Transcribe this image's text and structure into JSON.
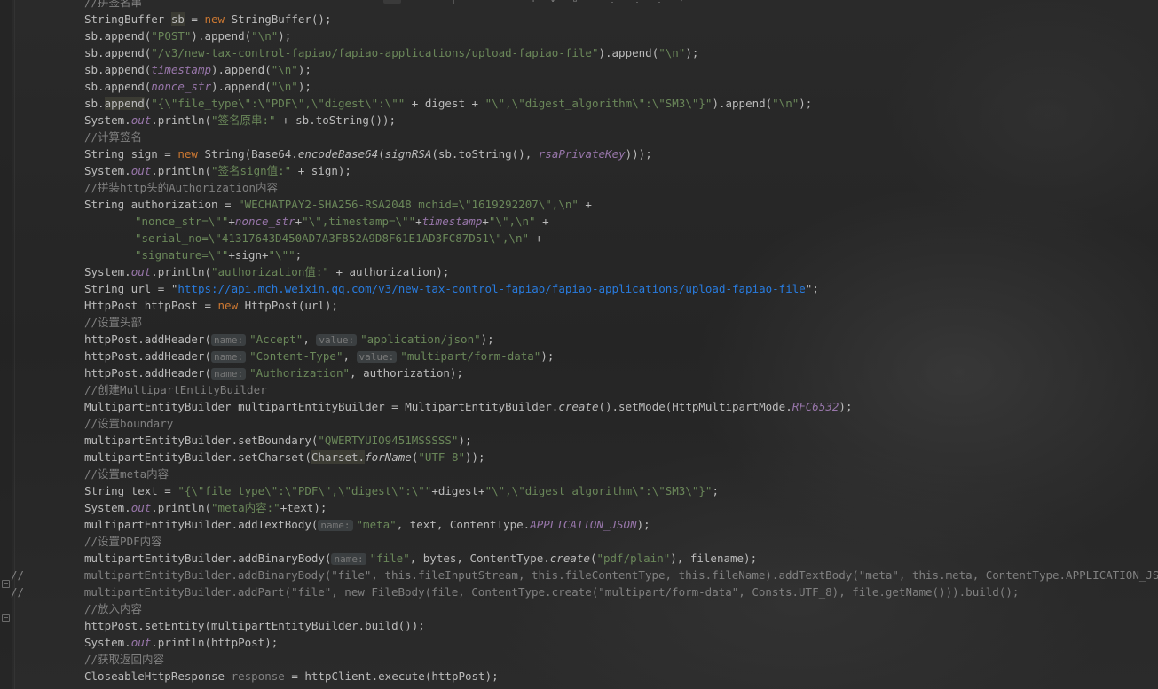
{
  "editor": {
    "language": "java",
    "lines": [
      {
        "indent": 95,
        "segments": [
          {
            "t": "//拼签名串",
            "c": "cmt"
          }
        ]
      },
      {
        "indent": 95,
        "segments": [
          {
            "t": "StringBuffer "
          },
          {
            "t": "sb",
            "c": "hl"
          },
          {
            "t": " = "
          },
          {
            "t": "new",
            "c": "kw"
          },
          {
            "t": " StringBuffer();"
          }
        ]
      },
      {
        "indent": 95,
        "segments": [
          {
            "t": "sb.append("
          },
          {
            "t": "\"POST\"",
            "c": "str"
          },
          {
            "t": ").append("
          },
          {
            "t": "\"\\n\"",
            "c": "str"
          },
          {
            "t": ");"
          }
        ]
      },
      {
        "indent": 95,
        "segments": [
          {
            "t": "sb.append("
          },
          {
            "t": "\"/v3/new-tax-control-fapiao/fapiao-applications/upload-fapiao-file\"",
            "c": "str"
          },
          {
            "t": ").append("
          },
          {
            "t": "\"\\n\"",
            "c": "str"
          },
          {
            "t": ");"
          }
        ]
      },
      {
        "indent": 95,
        "segments": [
          {
            "t": "sb.append("
          },
          {
            "t": "timestamp",
            "c": "fld"
          },
          {
            "t": ").append("
          },
          {
            "t": "\"\\n\"",
            "c": "str"
          },
          {
            "t": ");"
          }
        ]
      },
      {
        "indent": 95,
        "segments": [
          {
            "t": "sb.append("
          },
          {
            "t": "nonce_str",
            "c": "fld"
          },
          {
            "t": ").append("
          },
          {
            "t": "\"\\n\"",
            "c": "str"
          },
          {
            "t": ");"
          }
        ]
      },
      {
        "indent": 95,
        "segments": [
          {
            "t": "sb."
          },
          {
            "t": "append",
            "c": "hl"
          },
          {
            "t": "("
          },
          {
            "t": "\"{\\\"file_type\\\":\\\"PDF\\\",\\\"digest\\\":\\\"\"",
            "c": "str"
          },
          {
            "t": " + digest + "
          },
          {
            "t": "\"\\\",\\\"digest_algorithm\\\":\\\"SM3\\\"}\"",
            "c": "str"
          },
          {
            "t": ").append("
          },
          {
            "t": "\"\\n\"",
            "c": "str"
          },
          {
            "t": ");"
          }
        ]
      },
      {
        "indent": 95,
        "segments": [
          {
            "t": "System."
          },
          {
            "t": "out",
            "c": "fld"
          },
          {
            "t": ".println("
          },
          {
            "t": "\"签名原串:\"",
            "c": "str"
          },
          {
            "t": " + sb.toString());"
          }
        ]
      },
      {
        "indent": 95,
        "segments": [
          {
            "t": "//计算签名",
            "c": "cmt"
          }
        ]
      },
      {
        "indent": 95,
        "segments": [
          {
            "t": "String sign = "
          },
          {
            "t": "new",
            "c": "kw"
          },
          {
            "t": " String(Base64."
          },
          {
            "t": "encodeBase64",
            "c": "itl"
          },
          {
            "t": "("
          },
          {
            "t": "signRSA",
            "c": "itl"
          },
          {
            "t": "(sb.toString(), "
          },
          {
            "t": "rsaPrivateKey",
            "c": "fld"
          },
          {
            "t": ")));"
          }
        ]
      },
      {
        "indent": 95,
        "segments": [
          {
            "t": "System."
          },
          {
            "t": "out",
            "c": "fld"
          },
          {
            "t": ".println("
          },
          {
            "t": "\"签名sign值:\"",
            "c": "str"
          },
          {
            "t": " + sign);"
          }
        ]
      },
      {
        "indent": 95,
        "segments": [
          {
            "t": "//拼装http头的Authorization内容",
            "c": "cmt"
          }
        ]
      },
      {
        "indent": 95,
        "segments": [
          {
            "t": "String authorization = "
          },
          {
            "t": "\"WECHATPAY2-SHA256-RSA2048 mchid=\\\"1619292207\\\",\\n\"",
            "c": "str"
          },
          {
            "t": " +"
          }
        ]
      },
      {
        "indent": 152,
        "segments": [
          {
            "t": "\"nonce_str=\\\"\"",
            "c": "str"
          },
          {
            "t": "+"
          },
          {
            "t": "nonce_str",
            "c": "fld"
          },
          {
            "t": "+"
          },
          {
            "t": "\"\\\",timestamp=\\\"\"",
            "c": "str"
          },
          {
            "t": "+"
          },
          {
            "t": "timestamp",
            "c": "fld"
          },
          {
            "t": "+"
          },
          {
            "t": "\"\\\",\\n\"",
            "c": "str"
          },
          {
            "t": " +"
          }
        ]
      },
      {
        "indent": 152,
        "segments": [
          {
            "t": "\"serial_no=\\\"41317643D450AD7A3F852A9D8F61E1AD3FC87D51\\\",\\n\"",
            "c": "str"
          },
          {
            "t": " +"
          }
        ]
      },
      {
        "indent": 152,
        "segments": [
          {
            "t": "\"signature=\\\"\"",
            "c": "str"
          },
          {
            "t": "+sign+"
          },
          {
            "t": "\"\\\"\"",
            "c": "str"
          },
          {
            "t": ";"
          }
        ]
      },
      {
        "indent": 95,
        "segments": [
          {
            "t": "System."
          },
          {
            "t": "out",
            "c": "fld"
          },
          {
            "t": ".println("
          },
          {
            "t": "\"authorization值:\"",
            "c": "str"
          },
          {
            "t": " + authorization);"
          }
        ]
      },
      {
        "indent": 95,
        "segments": [
          {
            "t": "String url = "
          },
          {
            "t": "\""
          },
          {
            "t": "https://api.mch.weixin.qq.com/v3/new-tax-control-fapiao/fapiao-applications/upload-fapiao-file",
            "c": "url"
          },
          {
            "t": "\""
          },
          {
            "t": ";"
          }
        ]
      },
      {
        "indent": 95,
        "segments": [
          {
            "t": "HttpPost httpPost = "
          },
          {
            "t": "new",
            "c": "kw"
          },
          {
            "t": " HttpPost(url);"
          }
        ]
      },
      {
        "indent": 95,
        "segments": [
          {
            "t": "//设置头部",
            "c": "cmt"
          }
        ]
      },
      {
        "indent": 95,
        "segments": [
          {
            "t": "httpPost.addHeader("
          },
          {
            "t": "name:",
            "c": "hint"
          },
          {
            "t": "\"Accept\"",
            "c": "str"
          },
          {
            "t": ", "
          },
          {
            "t": "value:",
            "c": "hint"
          },
          {
            "t": "\"application/json\"",
            "c": "str"
          },
          {
            "t": ");"
          }
        ]
      },
      {
        "indent": 95,
        "segments": [
          {
            "t": "httpPost.addHeader("
          },
          {
            "t": "name:",
            "c": "hint"
          },
          {
            "t": "\"Content-Type\"",
            "c": "str"
          },
          {
            "t": ", "
          },
          {
            "t": "value:",
            "c": "hint"
          },
          {
            "t": "\"multipart/form-data\"",
            "c": "str"
          },
          {
            "t": ");"
          }
        ]
      },
      {
        "indent": 95,
        "segments": [
          {
            "t": "httpPost.addHeader("
          },
          {
            "t": "name:",
            "c": "hint"
          },
          {
            "t": "\"Authorization\"",
            "c": "str"
          },
          {
            "t": ", authorization);"
          }
        ]
      },
      {
        "indent": 95,
        "segments": [
          {
            "t": "//创建MultipartEntityBuilder",
            "c": "cmt"
          }
        ]
      },
      {
        "indent": 95,
        "segments": [
          {
            "t": "MultipartEntityBuilder multipartEntityBuilder = MultipartEntityBuilder."
          },
          {
            "t": "create",
            "c": "itl"
          },
          {
            "t": "().setMode(HttpMultipartMode."
          },
          {
            "t": "RFC6532",
            "c": "fld"
          },
          {
            "t": ");"
          }
        ]
      },
      {
        "indent": 95,
        "segments": [
          {
            "t": "//设置boundary",
            "c": "cmt"
          }
        ]
      },
      {
        "indent": 95,
        "segments": [
          {
            "t": "multipartEntityBuilder.setBoundary("
          },
          {
            "t": "\"QWERTYUIO9451MSSSSS\"",
            "c": "str"
          },
          {
            "t": ");"
          }
        ]
      },
      {
        "indent": 95,
        "segments": [
          {
            "t": "multipartEntityBuilder.setCharset("
          },
          {
            "t": "Charset.",
            "c": "hl"
          },
          {
            "t": "forName",
            "c": "itl"
          },
          {
            "t": "("
          },
          {
            "t": "\"UTF-8\"",
            "c": "str"
          },
          {
            "t": "));"
          }
        ]
      },
      {
        "indent": 95,
        "segments": [
          {
            "t": "//设置meta内容",
            "c": "cmt"
          }
        ]
      },
      {
        "indent": 95,
        "segments": [
          {
            "t": "String text = "
          },
          {
            "t": "\"{\\\"file_type\\\":\\\"PDF\\\",\\\"digest\\\":\\\"\"",
            "c": "str"
          },
          {
            "t": "+digest+"
          },
          {
            "t": "\"\\\",\\\"digest_algorithm\\\":\\\"SM3\\\"}\"",
            "c": "str"
          },
          {
            "t": ";"
          }
        ]
      },
      {
        "indent": 95,
        "segments": [
          {
            "t": "System."
          },
          {
            "t": "out",
            "c": "fld"
          },
          {
            "t": ".println("
          },
          {
            "t": "\"meta内容:\"",
            "c": "str"
          },
          {
            "t": "+text);"
          }
        ]
      },
      {
        "indent": 95,
        "segments": [
          {
            "t": "multipartEntityBuilder.addTextBody("
          },
          {
            "t": "name:",
            "c": "hint"
          },
          {
            "t": "\"meta\"",
            "c": "str"
          },
          {
            "t": ", text, ContentType."
          },
          {
            "t": "APPLICATION_JSON",
            "c": "fld"
          },
          {
            "t": ");"
          }
        ]
      },
      {
        "indent": 95,
        "segments": [
          {
            "t": "//设置PDF内容",
            "c": "cmt"
          }
        ]
      },
      {
        "indent": 95,
        "segments": [
          {
            "t": "multipartEntityBuilder.addBinaryBody("
          },
          {
            "t": "name:",
            "c": "hint"
          },
          {
            "t": "\"file\"",
            "c": "str"
          },
          {
            "t": ", bytes, ContentType."
          },
          {
            "t": "create",
            "c": "itl"
          },
          {
            "t": "("
          },
          {
            "t": "\"pdf/plain\"",
            "c": "str"
          },
          {
            "t": "), filename);"
          }
        ]
      },
      {
        "indent": 12,
        "segments": [
          {
            "t": "//",
            "c": "cmt"
          },
          {
            "t": "         multipartEntityBuilder.addBinaryBody(\"file\", this.fileInputStream, this.fileContentType, this.fileName).addTextBody(\"meta\", this.meta, ContentType.APPLICATION_JSON);",
            "c": "cmt"
          }
        ]
      },
      {
        "indent": 12,
        "segments": [
          {
            "t": "//",
            "c": "cmt"
          },
          {
            "t": "         multipartEntityBuilder.addPart(\"file\", new FileBody(file, ContentType.create(\"multipart/form-data\", Consts.UTF_8), file.getName())).build();",
            "c": "cmt"
          }
        ]
      },
      {
        "indent": 95,
        "segments": [
          {
            "t": "//放入内容",
            "c": "cmt"
          }
        ]
      },
      {
        "indent": 95,
        "segments": [
          {
            "t": "httpPost.setEntity(multipartEntityBuilder.build());"
          }
        ]
      },
      {
        "indent": 95,
        "segments": [
          {
            "t": "System."
          },
          {
            "t": "out",
            "c": "fld"
          },
          {
            "t": ".println(httpPost);"
          }
        ]
      },
      {
        "indent": 95,
        "segments": [
          {
            "t": "//获取返回内容",
            "c": "cmt"
          }
        ]
      },
      {
        "indent": 95,
        "segments": [
          {
            "t": "CloseableHttpResponse "
          },
          {
            "t": "response",
            "c": "cmt"
          },
          {
            "t": " = httpClient.execute(httpPost);"
          }
        ]
      }
    ]
  },
  "colors": {
    "background": "#262626",
    "default": "#bbbbbb",
    "keyword": "#cc7832",
    "string": "#6a8759",
    "comment": "#808080",
    "field": "#9876aa",
    "link": "#287bde"
  }
}
